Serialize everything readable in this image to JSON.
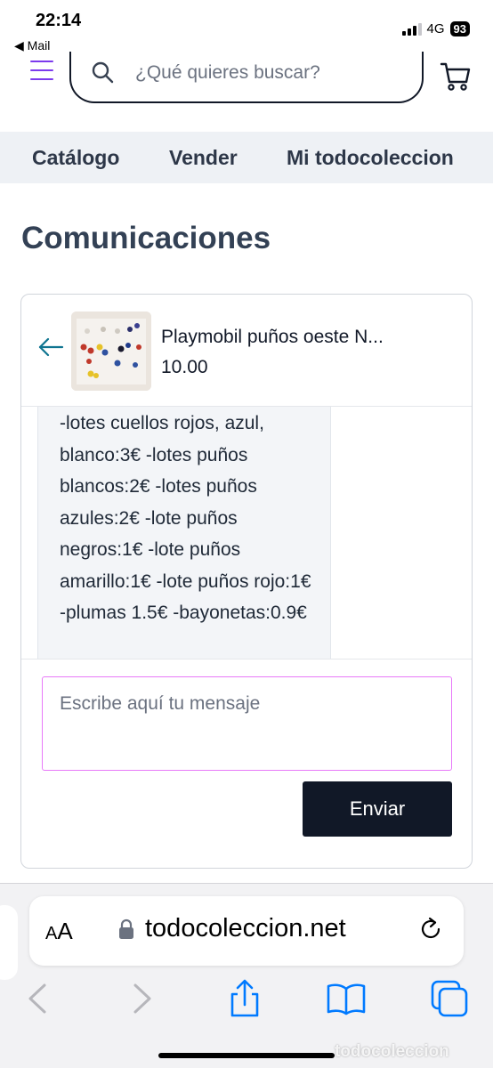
{
  "status_bar": {
    "time": "22:14",
    "back_app": "◀ Mail",
    "network": "4G",
    "battery": "93"
  },
  "header": {
    "search_placeholder": "¿Qué quieres buscar?"
  },
  "nav": {
    "items": [
      "Catálogo",
      "Vender",
      "Mi todocoleccion"
    ]
  },
  "page": {
    "title": "Comunicaciones"
  },
  "conversation": {
    "product_title": "Playmobil puños oeste N...",
    "product_price": "10.00",
    "message_text": "-lotes cuellos rojos, azul, blanco:3€ -lotes puños blancos:2€ -lotes puños azules:2€ -lote puños negros:1€ -lote puños amarillo:1€ -lote puños rojo:1€ -plumas 1.5€ -bayonetas:0.9€",
    "composer_placeholder": "Escribe aquí tu mensaje",
    "send_label": "Enviar"
  },
  "browser": {
    "aa_small": "A",
    "aa_big": "A",
    "url": "todocoleccion.net"
  },
  "watermark": "todocoleccion",
  "colors": {
    "accent_purple": "#7c3aed",
    "nav_bg": "#eef1f5",
    "send_button_bg": "#111827",
    "back_arrow_teal": "#0e7490",
    "composer_border": "#e879f9",
    "safari_blue": "#007aff"
  },
  "icons": [
    "menu-icon",
    "search-icon",
    "cart-icon",
    "back-arrow-icon",
    "lock-icon",
    "reload-icon",
    "back-nav-icon",
    "forward-nav-icon",
    "share-icon",
    "bookmarks-icon",
    "tabs-icon"
  ]
}
